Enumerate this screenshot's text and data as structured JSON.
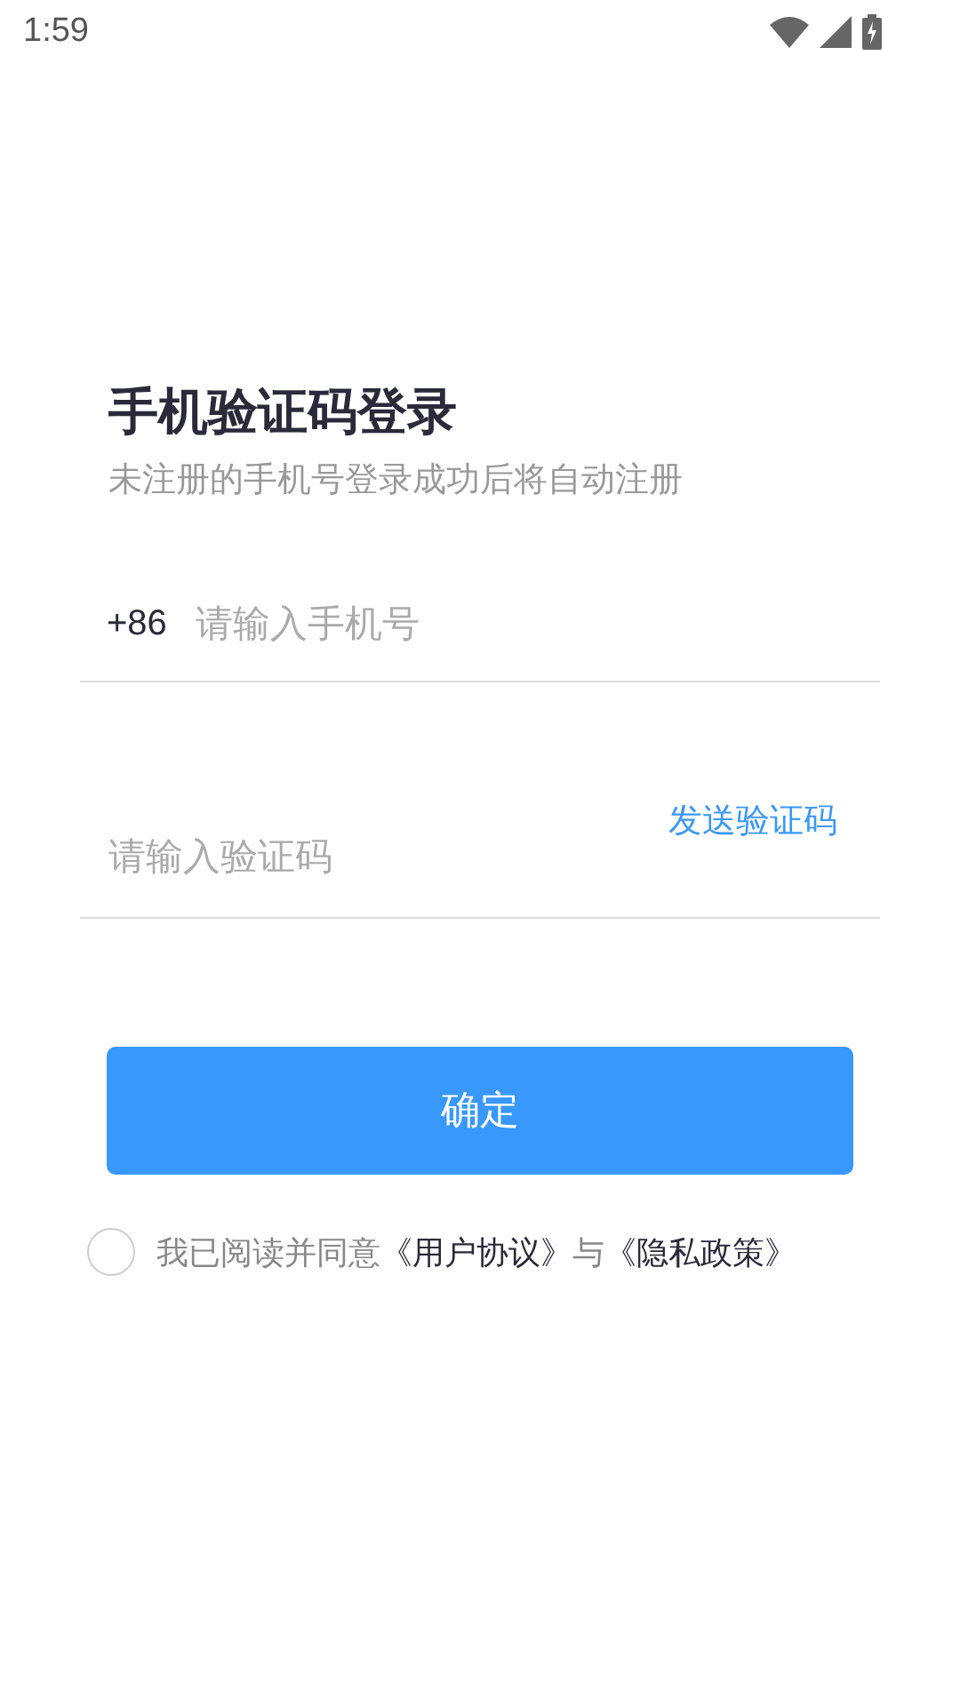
{
  "status_bar": {
    "time": "1:59"
  },
  "title": "手机验证码登录",
  "subtitle": "未注册的手机号登录成功后将自动注册",
  "phone": {
    "prefix": "+86",
    "placeholder": "请输入手机号"
  },
  "code": {
    "placeholder": "请输入验证码",
    "send_label": "发送验证码"
  },
  "confirm_button": "确定",
  "agreement": {
    "checked": false,
    "text": "我已阅读并同意",
    "link_1": "《用户协议》",
    "joiner": "与",
    "link_2": "《隐私政策》"
  }
}
